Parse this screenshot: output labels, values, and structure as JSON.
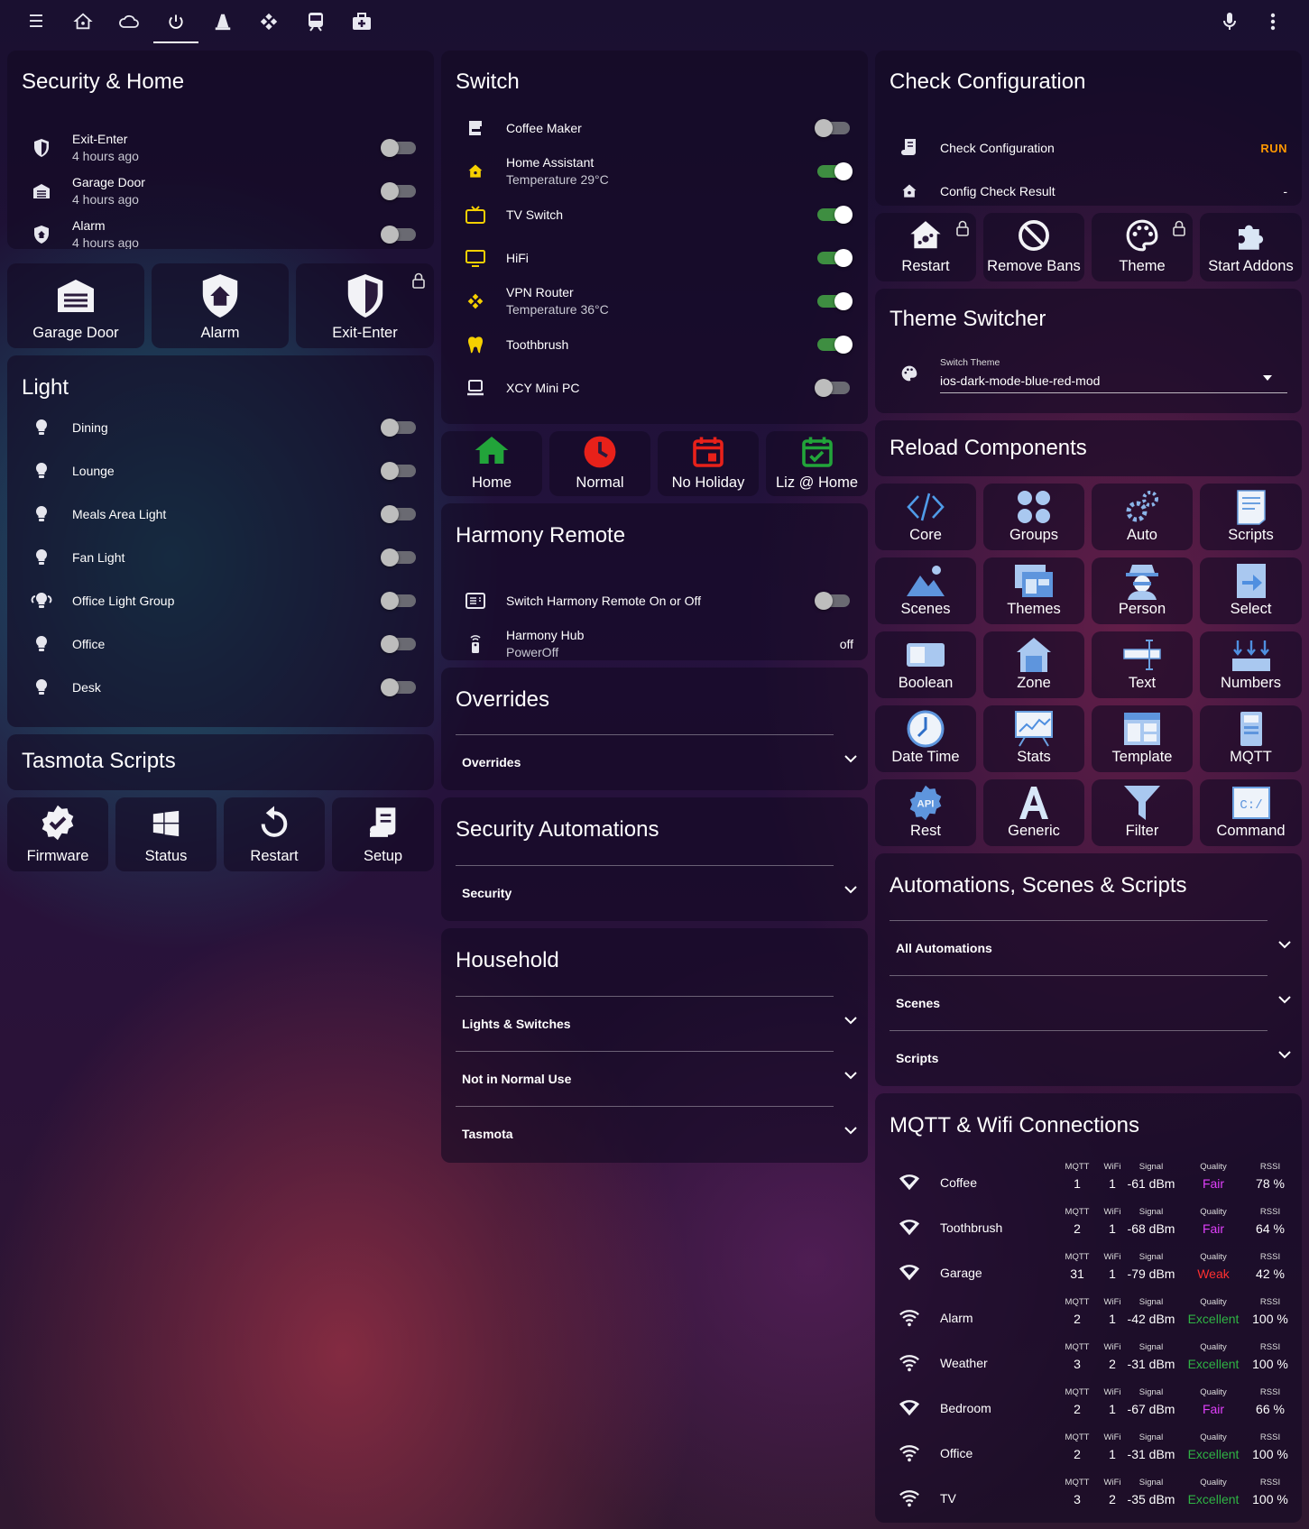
{
  "topbar": {
    "icons": [
      "menu-icon",
      "home-assistant-icon",
      "cloud-icon",
      "power-icon",
      "traffic-cone-icon",
      "kodi-icon",
      "train-icon",
      "medical-bag-icon"
    ],
    "right_icons": [
      "microphone-icon",
      "more-vert-icon"
    ]
  },
  "security_home": {
    "title": "Security & Home",
    "rows": [
      {
        "label": "Exit-Enter",
        "sub": "4 hours ago",
        "on": false
      },
      {
        "label": "Garage Door",
        "sub": "4 hours ago",
        "on": false
      },
      {
        "label": "Alarm",
        "sub": "4 hours ago",
        "on": false
      }
    ]
  },
  "security_buttons": [
    {
      "label": "Garage Door",
      "locked": false
    },
    {
      "label": "Alarm",
      "locked": false
    },
    {
      "label": "Exit-Enter",
      "locked": true
    }
  ],
  "light": {
    "title": "Light",
    "rows": [
      {
        "label": "Dining",
        "on": false
      },
      {
        "label": "Lounge",
        "on": false
      },
      {
        "label": "Meals Area Light",
        "on": false
      },
      {
        "label": "Fan Light",
        "on": false
      },
      {
        "label": "Office Light Group",
        "on": false
      },
      {
        "label": "Office",
        "on": false
      },
      {
        "label": "Desk",
        "on": false
      }
    ]
  },
  "tasmota": {
    "title": "Tasmota Scripts",
    "buttons": [
      {
        "label": "Firmware"
      },
      {
        "label": "Status"
      },
      {
        "label": "Restart"
      },
      {
        "label": "Setup"
      }
    ]
  },
  "switch": {
    "title": "Switch",
    "rows": [
      {
        "label": "Coffee Maker",
        "sub": "",
        "on": false,
        "icon_color": "#e6e6ee"
      },
      {
        "label": "Home Assistant",
        "sub": "Temperature 29°C",
        "on": true,
        "icon_color": "#f5d000"
      },
      {
        "label": "TV Switch",
        "sub": "",
        "on": true,
        "icon_color": "#f5d000"
      },
      {
        "label": "HiFi",
        "sub": "",
        "on": true,
        "icon_color": "#f5d000"
      },
      {
        "label": "VPN Router",
        "sub": "Temperature 36°C",
        "on": true,
        "icon_color": "#f5d000"
      },
      {
        "label": "Toothbrush",
        "sub": "",
        "on": true,
        "icon_color": "#f5d000"
      },
      {
        "label": "XCY Mini PC",
        "sub": "",
        "on": false,
        "icon_color": "#e6e6ee"
      }
    ]
  },
  "mode_buttons": [
    {
      "label": "Home",
      "color": "#22a43a"
    },
    {
      "label": "Normal",
      "color": "#e8211a"
    },
    {
      "label": "No Holiday",
      "color": "#e8211a"
    },
    {
      "label": "Liz @ Home",
      "color": "#22a43a"
    }
  ],
  "harmony": {
    "title": "Harmony Remote",
    "rows": [
      {
        "label": "Switch Harmony Remote On or Off",
        "on": false
      },
      {
        "label": "Harmony Hub",
        "sub": "PowerOff",
        "state": "off"
      }
    ]
  },
  "overrides": {
    "title": "Overrides",
    "items": [
      "Overrides"
    ]
  },
  "security_automations": {
    "title": "Security Automations",
    "items": [
      "Security"
    ]
  },
  "household": {
    "title": "Household",
    "items": [
      "Lights & Switches",
      "Not in Normal Use",
      "Tasmota"
    ]
  },
  "check_config": {
    "title": "Check Configuration",
    "rows": [
      {
        "label": "Check Configuration",
        "action": "RUN"
      },
      {
        "label": "Config Check Result",
        "state": "-"
      }
    ],
    "accent": "#ff9800"
  },
  "admin_buttons": [
    {
      "label": "Restart",
      "locked": true
    },
    {
      "label": "Remove Bans",
      "locked": false
    },
    {
      "label": "Theme",
      "locked": true
    },
    {
      "label": "Start Addons",
      "locked": false
    }
  ],
  "theme_switcher": {
    "title": "Theme Switcher",
    "select_label": "Switch Theme",
    "select_value": "ios-dark-mode-blue-red-mod"
  },
  "reload": {
    "title": "Reload Components",
    "buttons": [
      "Core",
      "Groups",
      "Auto",
      "Scripts",
      "Scenes",
      "Themes",
      "Person",
      "Select",
      "Boolean",
      "Zone",
      "Text",
      "Numbers",
      "Date Time",
      "Stats",
      "Template",
      "MQTT",
      "Rest",
      "Generic",
      "Filter",
      "Command"
    ]
  },
  "automations": {
    "title": "Automations, Scenes & Scripts",
    "items": [
      "All Automations",
      "Scenes",
      "Scripts"
    ]
  },
  "mqtt": {
    "title": "MQTT & Wifi Connections",
    "headers": {
      "mqtt": "MQTT",
      "wifi": "WiFi",
      "signal": "Signal",
      "quality": "Quality",
      "rssi": "RSSI"
    },
    "rows": [
      {
        "name": "Coffee",
        "mqtt": "1",
        "wifi": "1",
        "signal": "-61 dBm",
        "quality": "Fair",
        "rssi": "78 %",
        "qcolor": "#e040fb"
      },
      {
        "name": "Toothbrush",
        "mqtt": "2",
        "wifi": "1",
        "signal": "-68 dBm",
        "quality": "Fair",
        "rssi": "64 %",
        "qcolor": "#e040fb"
      },
      {
        "name": "Garage",
        "mqtt": "31",
        "wifi": "1",
        "signal": "-79 dBm",
        "quality": "Weak",
        "rssi": "42 %",
        "qcolor": "#ff3030"
      },
      {
        "name": "Alarm",
        "mqtt": "2",
        "wifi": "1",
        "signal": "-42 dBm",
        "quality": "Excellent",
        "rssi": "100 %",
        "qcolor": "#2fb344"
      },
      {
        "name": "Weather",
        "mqtt": "3",
        "wifi": "2",
        "signal": "-31 dBm",
        "quality": "Excellent",
        "rssi": "100 %",
        "qcolor": "#2fb344"
      },
      {
        "name": "Bedroom",
        "mqtt": "2",
        "wifi": "1",
        "signal": "-67 dBm",
        "quality": "Fair",
        "rssi": "66 %",
        "qcolor": "#e040fb"
      },
      {
        "name": "Office",
        "mqtt": "2",
        "wifi": "1",
        "signal": "-31 dBm",
        "quality": "Excellent",
        "rssi": "100 %",
        "qcolor": "#2fb344"
      },
      {
        "name": "TV",
        "mqtt": "3",
        "wifi": "2",
        "signal": "-35 dBm",
        "quality": "Excellent",
        "rssi": "100 %",
        "qcolor": "#2fb344"
      }
    ]
  }
}
